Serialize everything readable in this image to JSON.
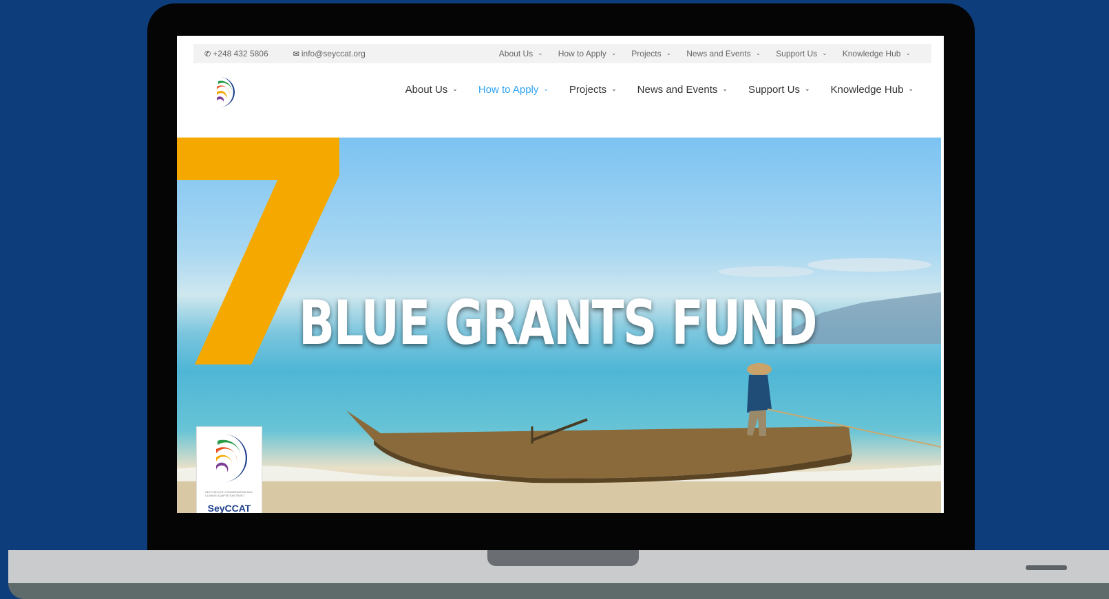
{
  "utility_bar": {
    "phone": "+248 432 5806",
    "email": "info@seyccat.org",
    "nav": [
      "About Us",
      "How to Apply",
      "Projects",
      "News and Events",
      "Support Us",
      "Knowledge Hub"
    ]
  },
  "main_nav": {
    "items": [
      "About Us",
      "How to Apply",
      "Projects",
      "News and Events",
      "Support Us",
      "Knowledge Hub"
    ],
    "active_index": 1
  },
  "hero": {
    "number": "7",
    "title": "BLUE GRANTS FUND",
    "badge_name": "SeyCCAT",
    "badge_caption": "SEYCHELLES' CONSERVATION AND CLIMATE ADAPTATION TRUST"
  },
  "colors": {
    "page_background": "#0e3d7b",
    "active_link": "#2ea3f2",
    "seven_accent": "#f5a800"
  },
  "icons": {
    "phone": "phone-icon",
    "email": "envelope-icon",
    "dropdown": "chevron-down-icon"
  }
}
